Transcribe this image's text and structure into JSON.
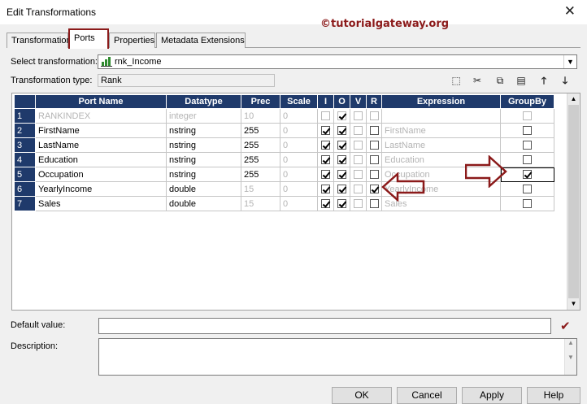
{
  "window": {
    "title": "Edit Transformations",
    "close_glyph": "✕"
  },
  "watermark": "©tutorialgateway.org",
  "tabs": [
    {
      "label": "Transformation"
    },
    {
      "label": "Ports",
      "active": true
    },
    {
      "label": "Properties"
    },
    {
      "label": "Metadata Extensions"
    }
  ],
  "select_transformation": {
    "label": "Select transformation:",
    "value": "rnk_Income",
    "icon": "rank-transformation-icon"
  },
  "transformation_type": {
    "label": "Transformation type:",
    "value": "Rank"
  },
  "toolbar": [
    {
      "name": "new-port-icon",
      "glyph": "⬚"
    },
    {
      "name": "cut-icon",
      "glyph": "✂"
    },
    {
      "name": "copy-icon",
      "glyph": "⧉"
    },
    {
      "name": "paste-icon",
      "glyph": "▤"
    },
    {
      "name": "move-up-icon",
      "glyph": "🡑"
    },
    {
      "name": "move-down-icon",
      "glyph": "🡓"
    }
  ],
  "grid": {
    "columns": [
      "Port Name",
      "Datatype",
      "Prec",
      "Scale",
      "I",
      "O",
      "V",
      "R",
      "Expression",
      "GroupBy"
    ],
    "rows": [
      {
        "num": "1",
        "name": "RANKINDEX",
        "datatype": "integer",
        "prec": "10",
        "scale": "0",
        "I": false,
        "O": true,
        "V": false,
        "R": false,
        "expression": "",
        "groupby": false,
        "system": true
      },
      {
        "num": "2",
        "name": "FirstName",
        "datatype": "nstring",
        "prec": "255",
        "scale": "0",
        "I": true,
        "O": true,
        "V": false,
        "R": false,
        "expression": "FirstName",
        "groupby": false
      },
      {
        "num": "3",
        "name": "LastName",
        "datatype": "nstring",
        "prec": "255",
        "scale": "0",
        "I": true,
        "O": true,
        "V": false,
        "R": false,
        "expression": "LastName",
        "groupby": false
      },
      {
        "num": "4",
        "name": "Education",
        "datatype": "nstring",
        "prec": "255",
        "scale": "0",
        "I": true,
        "O": true,
        "V": false,
        "R": false,
        "expression": "Education",
        "groupby": false
      },
      {
        "num": "5",
        "name": "Occupation",
        "datatype": "nstring",
        "prec": "255",
        "scale": "0",
        "I": true,
        "O": true,
        "V": false,
        "R": false,
        "expression": "Occupation",
        "groupby": true
      },
      {
        "num": "6",
        "name": "YearlyIncome",
        "datatype": "double",
        "prec": "15",
        "scale": "0",
        "I": true,
        "O": true,
        "V": false,
        "R": true,
        "expression": "YearlyIncome",
        "groupby": false
      },
      {
        "num": "7",
        "name": "Sales",
        "datatype": "double",
        "prec": "15",
        "scale": "0",
        "I": true,
        "O": true,
        "V": false,
        "R": false,
        "expression": "Sales",
        "groupby": false
      }
    ]
  },
  "default_value": {
    "label": "Default value:",
    "value": "",
    "validate_glyph": "✔"
  },
  "description": {
    "label": "Description:",
    "value": ""
  },
  "buttons": {
    "ok": "OK",
    "cancel": "Cancel",
    "apply": "Apply",
    "help": "Help"
  },
  "colors": {
    "header": "#1f3a6b",
    "annotation": "#8b1a1a"
  }
}
